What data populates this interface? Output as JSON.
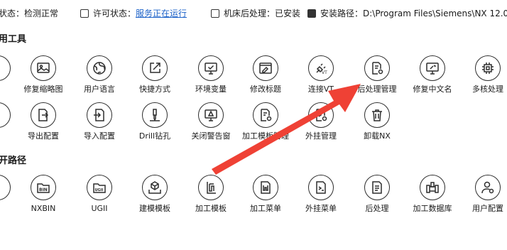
{
  "status_bar": [
    {
      "label": "状态：检测正常"
    },
    {
      "label": "许可状态：",
      "link": "服务正在运行"
    },
    {
      "label": "机床后处理：已安装"
    },
    {
      "label": "安装路径：D:\\Program Files\\Siemens\\NX 12.0"
    }
  ],
  "sections": {
    "tools_title": "用工具",
    "paths_title": "开路径"
  },
  "row1": [
    {
      "label": "X",
      "icon": "partial-icon"
    },
    {
      "label": "修复缩略图",
      "icon": "image-icon"
    },
    {
      "label": "用户语言",
      "icon": "globe-icon"
    },
    {
      "label": "快捷方式",
      "icon": "shortcut-icon"
    },
    {
      "label": "环境变量",
      "icon": "monitor-check-icon"
    },
    {
      "label": "修改标题",
      "icon": "edit-window-icon"
    },
    {
      "label": "连接VT",
      "icon": "plug-vt-icon"
    },
    {
      "label": "后处理管理",
      "icon": "doc-gear-icon"
    },
    {
      "label": "修复中文名",
      "icon": "monitor-wrench-icon"
    },
    {
      "label": "多核处理",
      "icon": "cpu-icon"
    }
  ],
  "row2": [
    {
      "label": "置",
      "icon": "partial-icon"
    },
    {
      "label": "导出配置",
      "icon": "export-config-icon"
    },
    {
      "label": "导入配置",
      "icon": "import-config-icon"
    },
    {
      "label": "Drill钻孔",
      "icon": "drill-icon"
    },
    {
      "label": "关闭警告窗",
      "icon": "warning-monitor-icon"
    },
    {
      "label": "加工模板管理",
      "icon": "template-gear-icon"
    },
    {
      "label": "外挂管理",
      "icon": "plugin-gear-icon"
    },
    {
      "label": "卸载NX",
      "icon": "trash-icon"
    }
  ],
  "row3": [
    {
      "label": "",
      "icon": "partial-icon"
    },
    {
      "label": "NXBIN",
      "icon": "folder-bin-icon",
      "badge": "BIN"
    },
    {
      "label": "UGII",
      "icon": "folder-ugii-icon",
      "badge": "UGII"
    },
    {
      "label": "建模模板",
      "icon": "cube-box-icon"
    },
    {
      "label": "加工模板",
      "icon": "machining-template-icon"
    },
    {
      "label": "加工菜单",
      "icon": "machining-menu-icon"
    },
    {
      "label": "外挂菜单",
      "icon": "plugin-menu-icon"
    },
    {
      "label": "后处理",
      "icon": "post-process-icon"
    },
    {
      "label": "加工数据库",
      "icon": "database-icon"
    },
    {
      "label": "用户配置",
      "icon": "user-gear-icon"
    }
  ]
}
